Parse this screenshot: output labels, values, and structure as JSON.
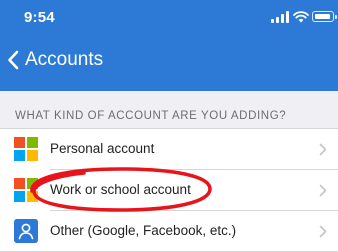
{
  "status_bar": {
    "time": "9:54"
  },
  "nav": {
    "back_label": "Accounts"
  },
  "section": {
    "title": "WHAT KIND OF ACCOUNT ARE YOU ADDING?"
  },
  "options": [
    {
      "label": "Personal account",
      "icon": "microsoft-logo-icon"
    },
    {
      "label": "Work or school account",
      "icon": "microsoft-logo-icon"
    },
    {
      "label": "Other (Google, Facebook, etc.)",
      "icon": "person-icon"
    }
  ],
  "colors": {
    "header": "#2c7ad6",
    "section_bg": "#efeff4",
    "annotation": "#e8141c",
    "ms_red": "#f25022",
    "ms_green": "#7fba00",
    "ms_blue": "#00a4ef",
    "ms_yellow": "#ffb900"
  }
}
